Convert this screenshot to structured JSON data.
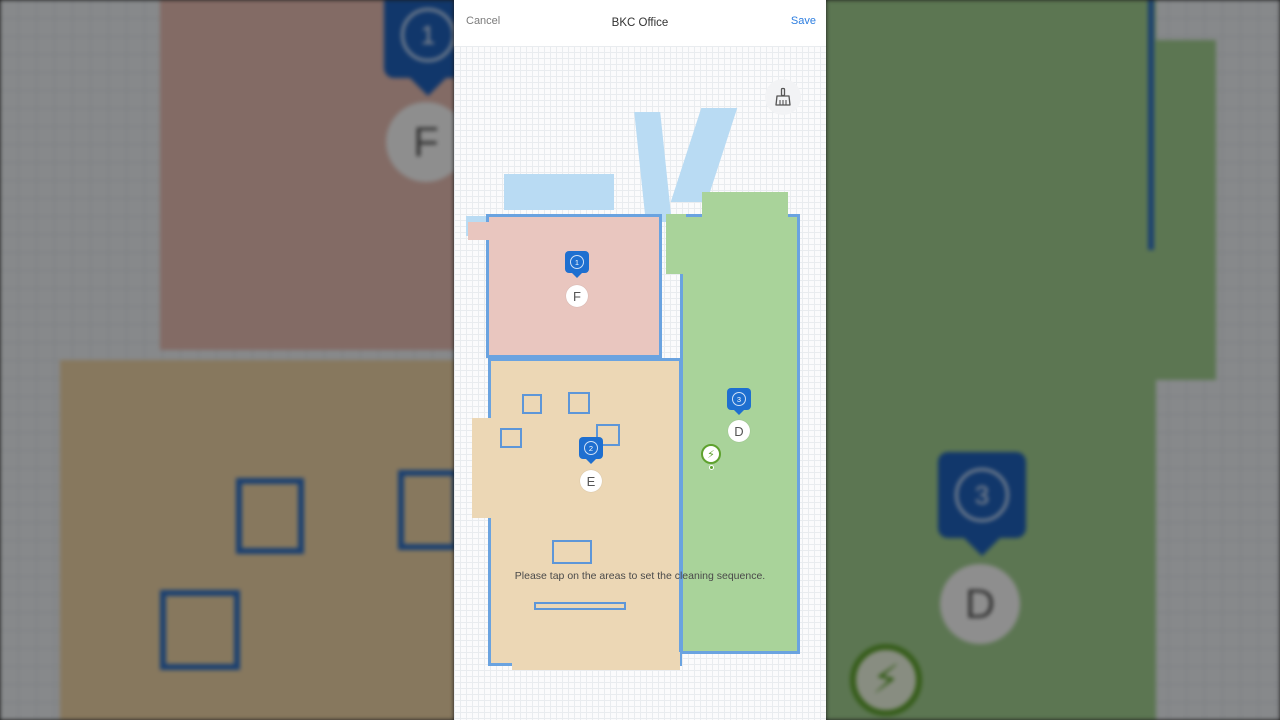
{
  "header": {
    "cancel_label": "Cancel",
    "title": "BKC Office",
    "save_label": "Save"
  },
  "toolbar": {
    "clean_icon": "broom-icon"
  },
  "rooms": [
    {
      "id": "F",
      "letter": "F",
      "order": "1",
      "color": "#e9c6bf"
    },
    {
      "id": "E",
      "letter": "E",
      "order": "2",
      "color": "#ecd7b5"
    },
    {
      "id": "D",
      "letter": "D",
      "order": "3",
      "color": "#a9d39a"
    }
  ],
  "charger": {
    "icon": "charging-dock-icon",
    "glyph": "⚡",
    "color": "#5ea12e"
  },
  "hint_text": "Please tap on the areas to set the cleaning sequence.",
  "colors": {
    "accent": "#2b7de0",
    "pin": "#1e6fd0",
    "wall": "#6aa3e0"
  }
}
